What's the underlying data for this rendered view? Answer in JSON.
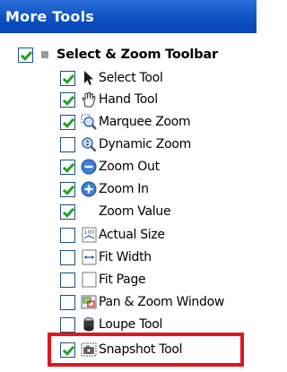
{
  "header": {
    "title": "More Tools"
  },
  "group": {
    "label": "Select & Zoom Toolbar",
    "checked": true
  },
  "items": [
    {
      "label": "Select Tool",
      "checked": true,
      "icon": "arrow-cursor-icon"
    },
    {
      "label": "Hand Tool",
      "checked": true,
      "icon": "hand-icon"
    },
    {
      "label": "Marquee Zoom",
      "checked": true,
      "icon": "marquee-zoom-icon"
    },
    {
      "label": "Dynamic Zoom",
      "checked": false,
      "icon": "dynamic-zoom-icon"
    },
    {
      "label": "Zoom Out",
      "checked": true,
      "icon": "zoom-out-icon"
    },
    {
      "label": "Zoom In",
      "checked": true,
      "icon": "zoom-in-icon"
    },
    {
      "label": "Zoom Value",
      "checked": true,
      "icon": ""
    },
    {
      "label": "Actual Size",
      "checked": false,
      "icon": "actual-size-icon"
    },
    {
      "label": "Fit Width",
      "checked": false,
      "icon": "fit-width-icon"
    },
    {
      "label": "Fit Page",
      "checked": false,
      "icon": "fit-page-icon"
    },
    {
      "label": "Pan & Zoom Window",
      "checked": false,
      "icon": "pan-zoom-window-icon"
    },
    {
      "label": "Loupe Tool",
      "checked": false,
      "icon": "loupe-icon"
    },
    {
      "label": "Snapshot Tool",
      "checked": true,
      "icon": "camera-icon"
    }
  ],
  "colors": {
    "header": "#0b4fc0",
    "check": "#21a121",
    "highlight": "#e0171d"
  }
}
